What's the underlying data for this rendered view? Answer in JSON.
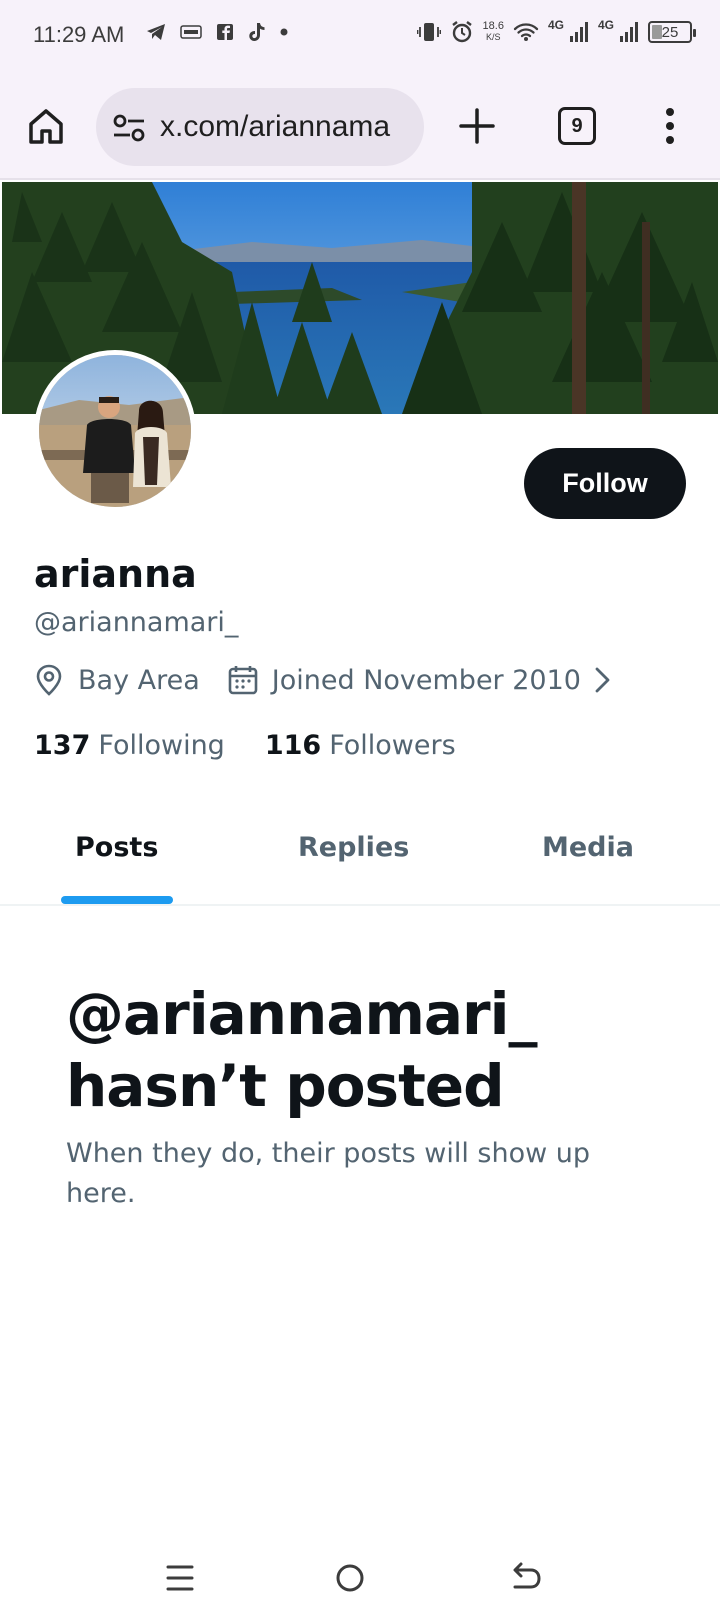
{
  "status_bar": {
    "time": "11:29 AM",
    "speed_value": "18.6",
    "speed_unit": "K/S",
    "network_1": "4G",
    "network_2": "4G",
    "battery": "25",
    "left_icons": [
      "telegram-icon",
      "temu-icon",
      "facebook-icon",
      "tiktok-icon",
      "dot-icon"
    ],
    "right_icons": [
      "vibrate-icon",
      "alarm-icon",
      "wifi-icon",
      "signal-icon",
      "signal-icon",
      "battery-icon"
    ]
  },
  "browser": {
    "url": "x.com/ariannama",
    "tab_count": "9",
    "icons": [
      "home-icon",
      "site-settings-icon",
      "new-tab-icon",
      "tabs-icon",
      "more-vert-icon"
    ]
  },
  "profile": {
    "follow_label": "Follow",
    "display_name": "arianna",
    "handle": "@ariannamari_",
    "location": "Bay Area",
    "joined": "Joined November 2010",
    "following_count": "137",
    "following_label": "Following",
    "followers_count": "116",
    "followers_label": "Followers"
  },
  "tabs": [
    {
      "label": "Posts",
      "active": true
    },
    {
      "label": "Replies",
      "active": false
    },
    {
      "label": "Media",
      "active": false
    }
  ],
  "empty_state": {
    "title_line1": "@ariannamari_",
    "title_line2": "hasn’t posted",
    "subtitle": "When they do, their posts will show up here."
  },
  "colors": {
    "accent": "#1d9bf0",
    "text_primary": "#0f1419",
    "text_secondary": "#536471",
    "follow_button": "#0f1419"
  }
}
